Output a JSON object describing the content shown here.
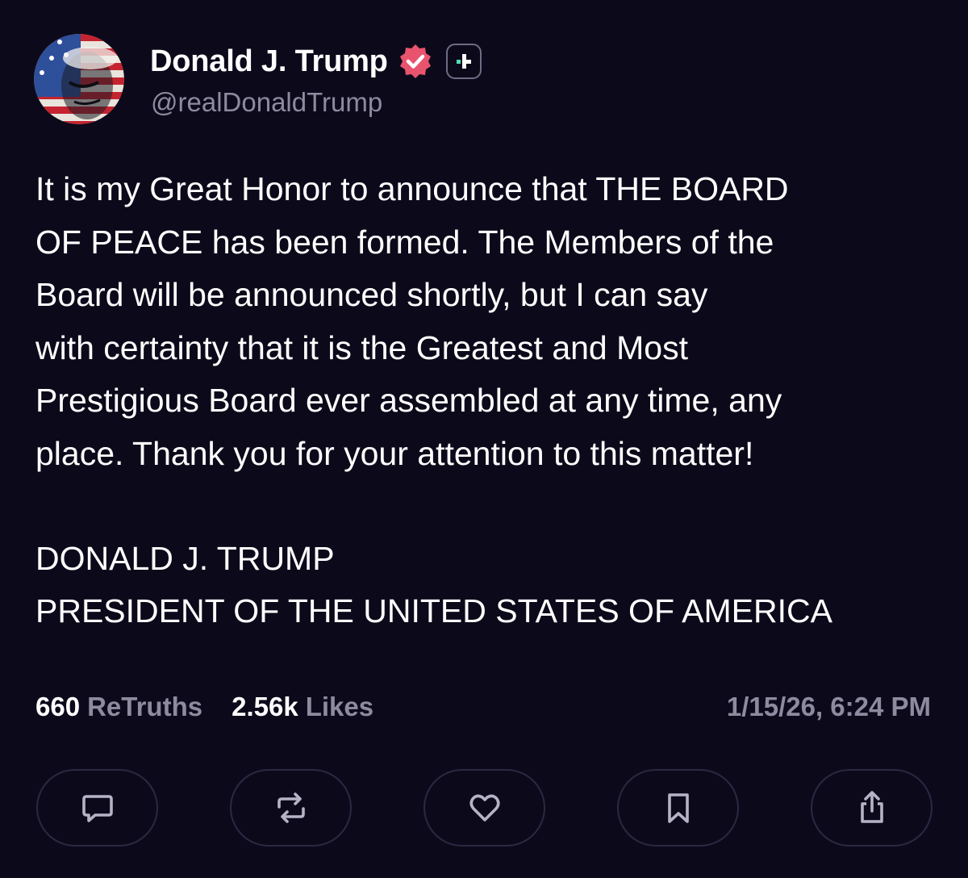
{
  "author": {
    "display_name": "Donald J. Trump",
    "handle": "@realDonaldTrump",
    "avatar_icon": "flag-face-avatar",
    "verified_icon": "verified-badge-icon",
    "plus_icon": "truth-plus-icon"
  },
  "post": {
    "body": "It is my Great Honor to announce that THE BOARD\nOF PEACE has been formed. The Members of the\nBoard will be announced shortly, but I can say\nwith certainty that it is the Greatest and Most\nPrestigious Board ever assembled at any time, any\nplace. Thank you for your attention to this matter!",
    "signature_line1": "DONALD J. TRUMP",
    "signature_line2": "PRESIDENT OF THE UNITED STATES OF AMERICA"
  },
  "stats": {
    "retruths_count": "660",
    "retruths_label": "ReTruths",
    "likes_count": "2.56k",
    "likes_label": "Likes",
    "timestamp": "1/15/26, 6:24 PM"
  },
  "actions": [
    {
      "name": "reply",
      "icon": "comment-icon"
    },
    {
      "name": "retruth",
      "icon": "repost-icon"
    },
    {
      "name": "like",
      "icon": "heart-icon"
    },
    {
      "name": "bookmark",
      "icon": "bookmark-icon"
    },
    {
      "name": "share",
      "icon": "share-icon"
    }
  ],
  "colors": {
    "background": "#0c0a1a",
    "text": "#ffffff",
    "muted": "#8e8a9f",
    "verified_pink": "#e8536d",
    "plus_accent": "#4ee0b5",
    "button_border": "#2b2842"
  }
}
